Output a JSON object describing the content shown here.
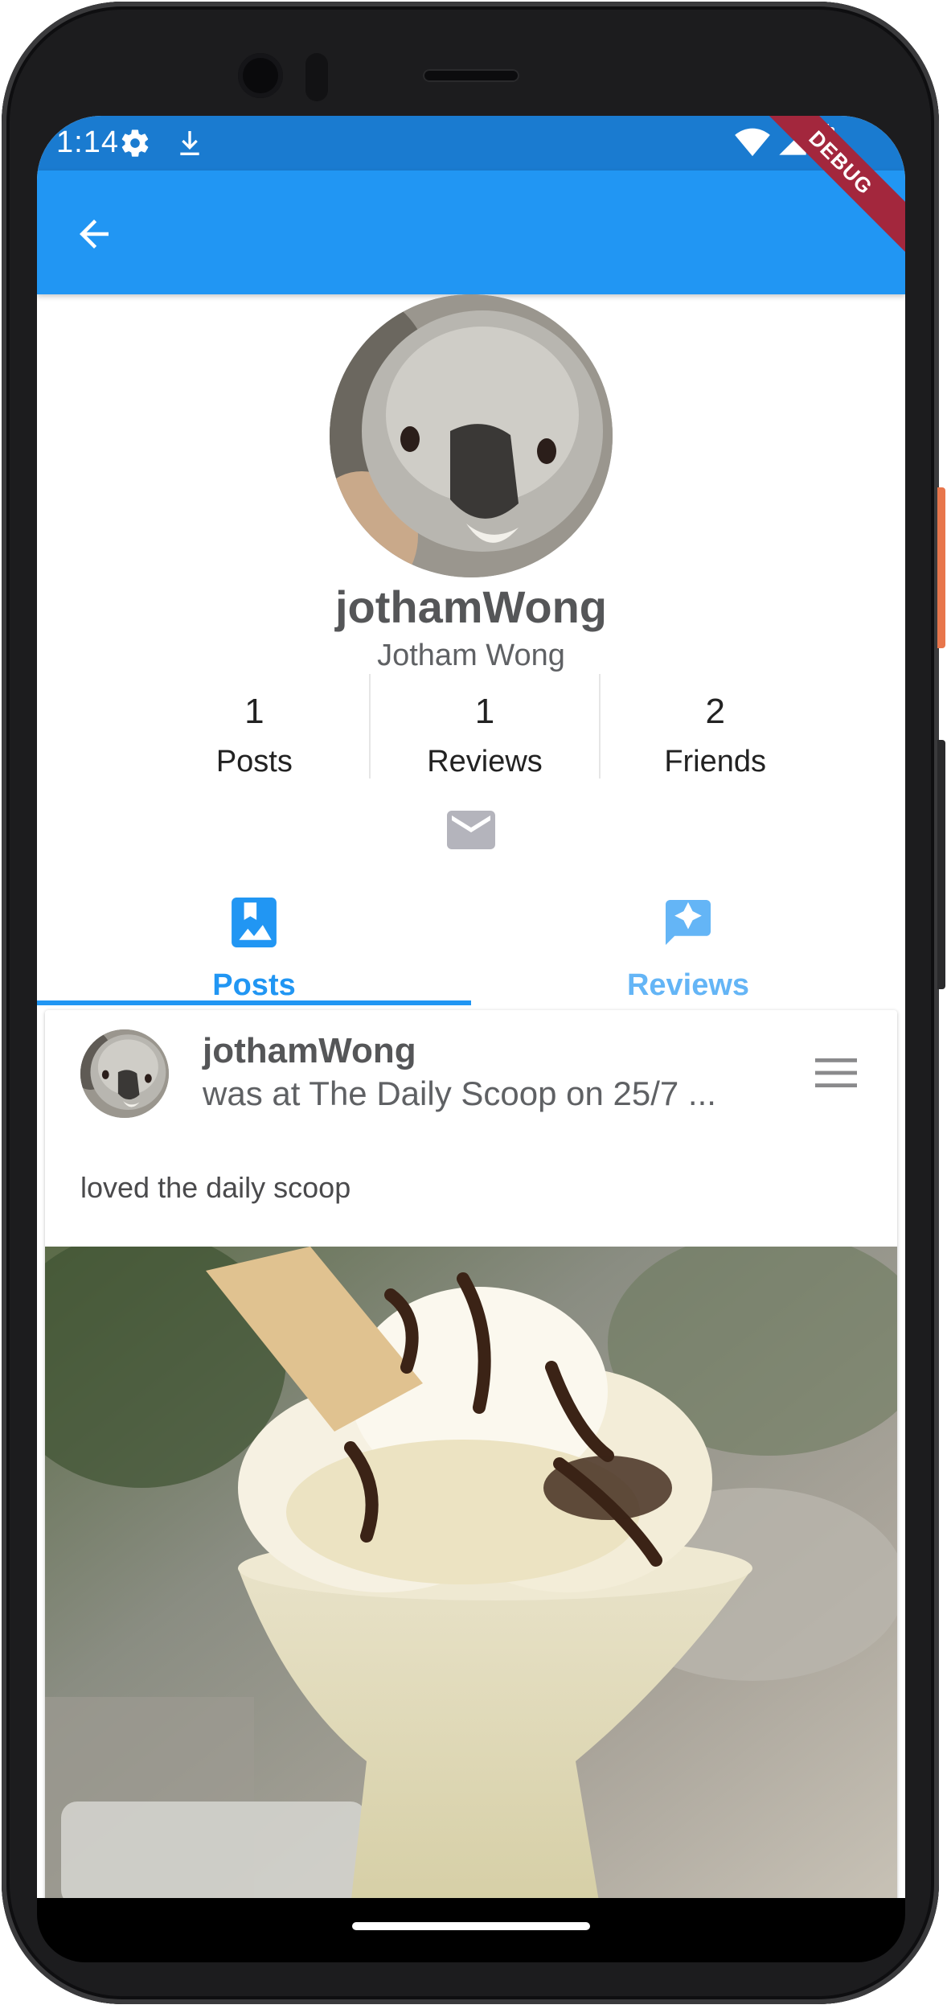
{
  "status_bar": {
    "time": "1:14",
    "icons": [
      "settings-icon",
      "download-icon",
      "wifi-icon",
      "signal-icon",
      "battery-icon"
    ]
  },
  "debug_banner": "DEBUG",
  "app_bar": {
    "back_icon": "arrow-back-icon",
    "color": "#2196f3"
  },
  "profile": {
    "username": "jothamWong",
    "full_name": "Jotham Wong",
    "stats": [
      {
        "value": "1",
        "label": "Posts"
      },
      {
        "value": "1",
        "label": "Reviews"
      },
      {
        "value": "2",
        "label": "Friends"
      }
    ],
    "message_icon": "mail-icon"
  },
  "tabs": [
    {
      "label": "Posts",
      "icon": "photo-bookmark-icon",
      "selected": true
    },
    {
      "label": "Reviews",
      "icon": "rate-review-icon",
      "selected": false
    }
  ],
  "post": {
    "username": "jothamWong",
    "subtitle": "was at The Daily Scoop on 25/7 ...",
    "caption": "loved the daily scoop",
    "menu_icon": "menu-icon"
  },
  "colors": {
    "accent": "#2196f3",
    "status_bar": "#1a7bd0",
    "tab_inactive": "#64b5f6",
    "debug": "#a3273d"
  }
}
